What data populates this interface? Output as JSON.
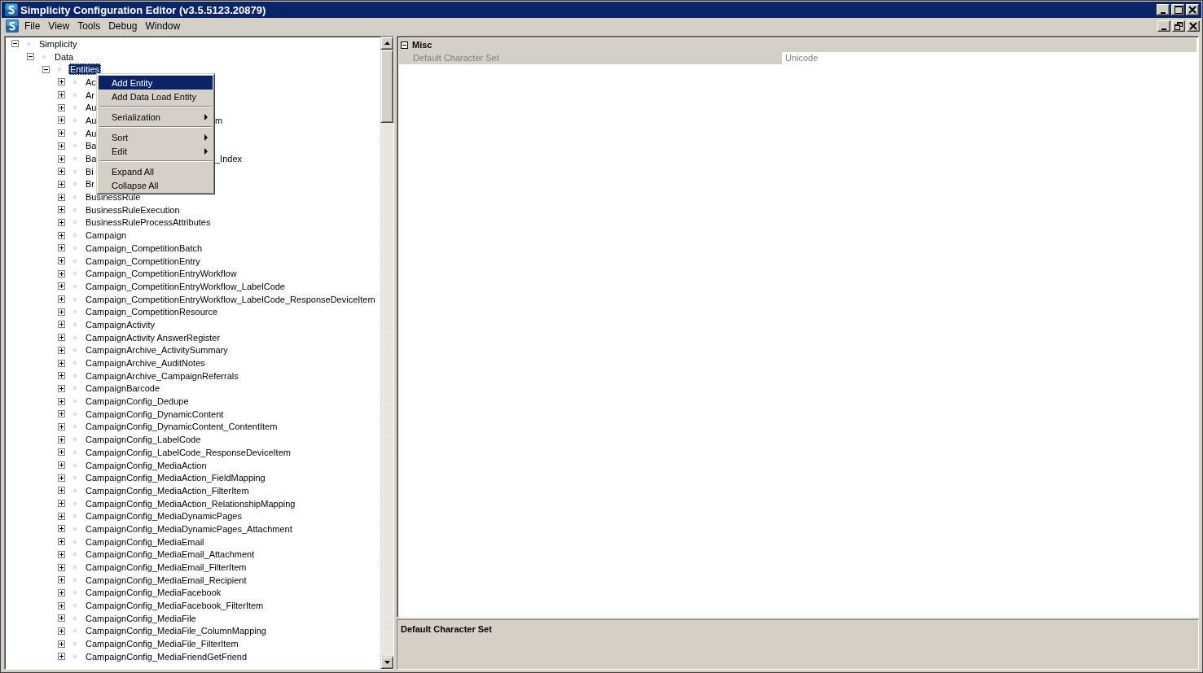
{
  "window": {
    "title": "Simplicity Configuration Editor (v3.5.5123.20879)"
  },
  "menu_bar": [
    "File",
    "View",
    "Tools",
    "Debug",
    "Window"
  ],
  "tree": [
    {
      "label": "Simplicity",
      "expanded": true,
      "selected": false,
      "children": [
        {
          "label": "Data",
          "expanded": true,
          "selected": false,
          "children": [
            {
              "label": "Entities",
              "expanded": true,
              "selected": true,
              "children": [
                {
                  "label": "Ac",
                  "expanded": false,
                  "selected": false
                },
                {
                  "label": "Ar",
                  "expanded": false,
                  "selected": false
                },
                {
                  "label": "Au",
                  "expanded": false,
                  "selected": false
                },
                {
                  "label": "Au",
                  "tail": "m",
                  "expanded": false,
                  "selected": false
                },
                {
                  "label": "Au",
                  "expanded": false,
                  "selected": false
                },
                {
                  "label": "Ba",
                  "expanded": false,
                  "selected": false
                },
                {
                  "label": "Ba",
                  "tail": "_Index",
                  "expanded": false,
                  "selected": false
                },
                {
                  "label": "Bi",
                  "expanded": false,
                  "selected": false
                },
                {
                  "label": "Br",
                  "expanded": false,
                  "selected": false
                },
                {
                  "label": "BusinessRule",
                  "expanded": false,
                  "selected": false
                },
                {
                  "label": "BusinessRuleExecution",
                  "expanded": false,
                  "selected": false
                },
                {
                  "label": "BusinessRuleProcessAttributes",
                  "expanded": false,
                  "selected": false
                },
                {
                  "label": "Campaign",
                  "expanded": false,
                  "selected": false
                },
                {
                  "label": "Campaign_CompetitionBatch",
                  "expanded": false,
                  "selected": false
                },
                {
                  "label": "Campaign_CompetitionEntry",
                  "expanded": false,
                  "selected": false
                },
                {
                  "label": "Campaign_CompetitionEntryWorkflow",
                  "expanded": false,
                  "selected": false
                },
                {
                  "label": "Campaign_CompetitionEntryWorkflow_LabelCode",
                  "expanded": false,
                  "selected": false
                },
                {
                  "label": "Campaign_CompetitionEntryWorkflow_LabelCode_ResponseDeviceItem",
                  "expanded": false,
                  "selected": false
                },
                {
                  "label": "Campaign_CompetitionResource",
                  "expanded": false,
                  "selected": false
                },
                {
                  "label": "CampaignActivity",
                  "expanded": false,
                  "selected": false
                },
                {
                  "label": "CampaignActivity AnswerRegister",
                  "expanded": false,
                  "selected": false
                },
                {
                  "label": "CampaignArchive_ActivitySummary",
                  "expanded": false,
                  "selected": false
                },
                {
                  "label": "CampaignArchive_AuditNotes",
                  "expanded": false,
                  "selected": false
                },
                {
                  "label": "CampaignArchive_CampaignReferrals",
                  "expanded": false,
                  "selected": false
                },
                {
                  "label": "CampaignBarcode",
                  "expanded": false,
                  "selected": false
                },
                {
                  "label": "CampaignConfig_Dedupe",
                  "expanded": false,
                  "selected": false
                },
                {
                  "label": "CampaignConfig_DynamicContent",
                  "expanded": false,
                  "selected": false
                },
                {
                  "label": "CampaignConfig_DynamicContent_ContentItem",
                  "expanded": false,
                  "selected": false
                },
                {
                  "label": "CampaignConfig_LabelCode",
                  "expanded": false,
                  "selected": false
                },
                {
                  "label": "CampaignConfig_LabelCode_ResponseDeviceItem",
                  "expanded": false,
                  "selected": false
                },
                {
                  "label": "CampaignConfig_MediaAction",
                  "expanded": false,
                  "selected": false
                },
                {
                  "label": "CampaignConfig_MediaAction_FieldMapping",
                  "expanded": false,
                  "selected": false
                },
                {
                  "label": "CampaignConfig_MediaAction_FilterItem",
                  "expanded": false,
                  "selected": false
                },
                {
                  "label": "CampaignConfig_MediaAction_RelationshipMapping",
                  "expanded": false,
                  "selected": false
                },
                {
                  "label": "CampaignConfig_MediaDynamicPages",
                  "expanded": false,
                  "selected": false
                },
                {
                  "label": "CampaignConfig_MediaDynamicPages_Attachment",
                  "expanded": false,
                  "selected": false
                },
                {
                  "label": "CampaignConfig_MediaEmail",
                  "expanded": false,
                  "selected": false
                },
                {
                  "label": "CampaignConfig_MediaEmail_Attachment",
                  "expanded": false,
                  "selected": false
                },
                {
                  "label": "CampaignConfig_MediaEmail_FilterItem",
                  "expanded": false,
                  "selected": false
                },
                {
                  "label": "CampaignConfig_MediaEmail_Recipient",
                  "expanded": false,
                  "selected": false
                },
                {
                  "label": "CampaignConfig_MediaFacebook",
                  "expanded": false,
                  "selected": false
                },
                {
                  "label": "CampaignConfig_MediaFacebook_FilterItem",
                  "expanded": false,
                  "selected": false
                },
                {
                  "label": "CampaignConfig_MediaFile",
                  "expanded": false,
                  "selected": false
                },
                {
                  "label": "CampaignConfig_MediaFile_ColumnMapping",
                  "expanded": false,
                  "selected": false
                },
                {
                  "label": "CampaignConfig_MediaFile_FilterItem",
                  "expanded": false,
                  "selected": false
                },
                {
                  "label": "CampaignConfig_MediaFriendGetFriend",
                  "expanded": false,
                  "selected": false
                }
              ]
            }
          ]
        }
      ]
    }
  ],
  "context_menu": {
    "groups": [
      [
        {
          "label": "Add Entity",
          "selected": true,
          "submenu": false
        },
        {
          "label": "Add Data Load Entity",
          "selected": false,
          "submenu": false
        }
      ],
      [
        {
          "label": "Serialization",
          "selected": false,
          "submenu": true
        }
      ],
      [
        {
          "label": "Sort",
          "selected": false,
          "submenu": true
        },
        {
          "label": "Edit",
          "selected": false,
          "submenu": true
        }
      ],
      [
        {
          "label": "Expand All",
          "selected": false,
          "submenu": false
        },
        {
          "label": "Collapse All",
          "selected": false,
          "submenu": false
        }
      ]
    ]
  },
  "property_grid": {
    "categories": [
      {
        "name": "Misc",
        "expanded": true,
        "properties": [
          {
            "name": "Default Character Set",
            "value": "Unicode"
          }
        ]
      }
    ],
    "description": {
      "title": "Default Character Set"
    }
  }
}
